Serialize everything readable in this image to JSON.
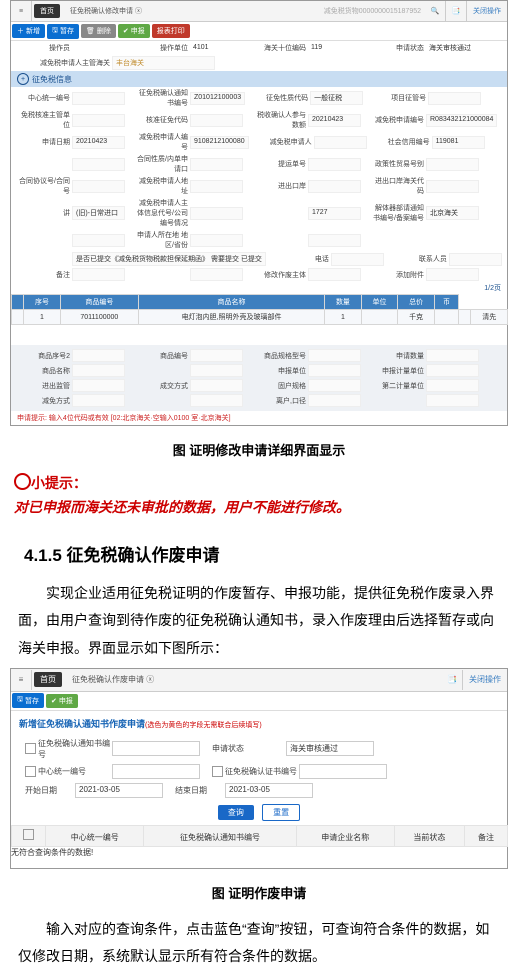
{
  "topApp": {
    "topbar": {
      "menu_icon": "menu-icon",
      "home": "首页",
      "tab": "征免税确认修改申请",
      "search_value": "减免税货物0000000015187952",
      "search_icon": "search-icon",
      "print_icon": "print-icon",
      "close": "关闭操作"
    },
    "toolbar": {
      "add": "新增",
      "save": "暂存",
      "del": "删除",
      "report": "申报",
      "print": "报表打印"
    },
    "row1": {
      "l1": "操作员",
      "v1": " ",
      "l2": "操作单位",
      "v2": "4101",
      "l3": "海关十位编码",
      "v3": "119",
      "l4": "申请状态",
      "v4": "海关审核通过"
    },
    "row2": {
      "l1": "减免税申请人主管海关",
      "v1": "丰台海关"
    },
    "section1": "征免税信息",
    "baseFields": [
      {
        "l": "中心统一编号",
        "v": ""
      },
      {
        "l": "征免税确认通知书编号",
        "v": "Z01012100003"
      },
      {
        "l": "征免性质代码",
        "v": "一般征税"
      },
      {
        "l": "项目征管号",
        "v": ""
      },
      {
        "l": "免税核准主管单位",
        "v": ""
      },
      {
        "l": "核准征免代码",
        "v": ""
      },
      {
        "l": "税收确认人参与数额",
        "v": "20210423"
      },
      {
        "l": "减免税申请编号",
        "v": "R083432121000084"
      },
      {
        "l": "申请日期",
        "v": "20210423"
      },
      {
        "l": "减免税申请人编号",
        "v": "9108212100080"
      },
      {
        "l": "减免税申请人",
        "v": ""
      },
      {
        "l": "社会信用编号",
        "v": "119081"
      },
      {
        "l": " ",
        "v": " "
      },
      {
        "l": "合同性质/内单申请口",
        "v": ""
      },
      {
        "l": "提运单号",
        "v": ""
      },
      {
        "l": "政策性贸易号别",
        "v": ""
      },
      {
        "l": "合同协议号/合同号",
        "v": ""
      },
      {
        "l": "减免税申请人地址",
        "v": ""
      },
      {
        "l": "进出口岸",
        "v": ""
      },
      {
        "l": "进出口岸海关代码",
        "v": ""
      },
      {
        "l": "讲",
        "v": "(旧)-日常进口"
      },
      {
        "l": "减免税申请人主体信息代号/公司编号情况",
        "v": ""
      },
      {
        "l": " ",
        "v": "1727 "
      },
      {
        "l": "解体器部请通知书编号/备案编号",
        "v": "北京海关"
      },
      {
        "l": " ",
        "v": ""
      },
      {
        "l": "申请人所在地 地区/省份",
        "v": ""
      },
      {
        "l": " ",
        "v": " "
      },
      {
        "l": "",
        "v": "是否已提交《减免税货物税款担保延期函》 需要提交 已提交"
      },
      {
        "l": "电话",
        "v": ""
      },
      {
        "l": "联系人员",
        "v": ""
      },
      {
        "l": "备注",
        "v": ""
      },
      {
        "l": "",
        "v": ""
      },
      {
        "l": "修改作废主体",
        "v": ""
      },
      {
        "l": "添加附件",
        "v": ""
      }
    ],
    "countBadge": "1/2页",
    "grid": {
      "headers": [
        "",
        "序号",
        "商品编号",
        "商品名称",
        "数量",
        "单位",
        "总价",
        "币"
      ],
      "row": [
        "",
        "1",
        "7011100000",
        "电灯泡内胆,照明外壳及玻璃部件",
        "1",
        "",
        "千克",
        "",
        "",
        "清先"
      ]
    },
    "lower": [
      {
        "l": "商品序号2",
        "v": ""
      },
      {
        "l": "商品编号",
        "v": ""
      },
      {
        "l": "商品规格型号",
        "v": ""
      },
      {
        "l": "申请数量",
        "v": ""
      },
      {
        "l": "商品名称",
        "v": ""
      },
      {
        "l": " ",
        "v": ""
      },
      {
        "l": "申报单位",
        "v": ""
      },
      {
        "l": "申报计量单位",
        "v": ""
      },
      {
        "l": "进出监管",
        "v": ""
      },
      {
        "l": "成交方式",
        "v": ""
      },
      {
        "l": "固户规格",
        "v": ""
      },
      {
        "l": "第二计量单位",
        "v": ""
      },
      {
        "l": "减免方式",
        "v": ""
      },
      {
        "l": " ",
        "v": ""
      },
      {
        "l": "离户,口径",
        "v": ""
      },
      {
        "l": " ",
        "v": ""
      }
    ],
    "bottomHint": "申请提示: 输入4位代码或有效 [02:北京海关·空输入0100 室·北京海关]"
  },
  "caption1": "图  证明修改申请详细界面显示",
  "tip_label": "小提示：",
  "warn_text": "对已申报而海关还未审批的数据，用户不能进行修改。",
  "section_num": "4.1.5 征免税确认作废申请",
  "para1_a": "实现企业适用征免税证明的作废暂存、申报功能，提供征免税作废录入界面，由用户查询到待作废的征免税确认通知书，录入作废理由后选择暂存或向海关申报。界面显示如下图所示：",
  "bottomApp": {
    "topbar": {
      "menu_icon": "menu-icon",
      "home": "首页",
      "tab": "征免税确认作废申请",
      "close": "关闭操作"
    },
    "toolbar": {
      "save": "暂存",
      "report": "申报"
    },
    "big_title": "新增征免税确认通知书作废申请",
    "big_warn": "(选色为黄色的字段无需联合后续填写)",
    "filters": {
      "f1_l": "征免税确认通知书编号",
      "f1_v": "",
      "f2_l": "申请状态",
      "f2_v": "海关审核通过",
      "f3_l": "中心统一编号",
      "f3_v": "",
      "f4_l": "征免税确认证书编号",
      "f4_v": "",
      "f5_l": "开始日期",
      "f5_v": "2021-03-05",
      "f6_l": "结束日期",
      "f6_v": "2021-03-05"
    },
    "btn_query": "查询",
    "btn_reset": "重置",
    "grid_headers": [
      "",
      "中心统一编号",
      "征免税确认通知书编号",
      "申请企业名称",
      "当前状态",
      "备注"
    ],
    "no_data": "无符合查询条件的数据!"
  },
  "caption2": "图  证明作废申请",
  "para2": "输入对应的查询条件，点击蓝色“查询”按钮，可查询符合条件的数据，如仅修改日期，系统默认显示所有符合条件的数据。"
}
